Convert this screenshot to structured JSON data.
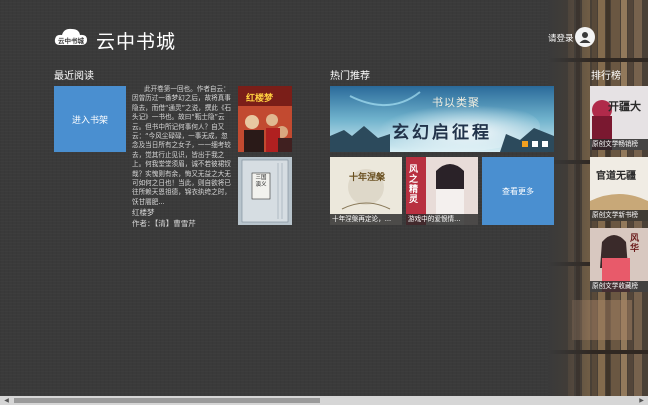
{
  "header": {
    "logo_text": "云中书城",
    "title": "云中书城",
    "login_label": "请登录"
  },
  "recent": {
    "heading": "最近阅读",
    "enter_shelf_label": "进入书架",
    "summary": "此开卷第一回也。作者自云：因曾历过一番梦幻之后，故将真事隐去，而借“通灵”之说，撰此《石头记》一书也。故曰“甄士隐”云云。但书中所记何事何人？自又云：“今风尘碌碌，一事无成，忽念及当日所有之女子，一一细考较去，觉其行止见识，皆出于我之上。何我堂堂须眉，诚不若彼裙钗哉？实愧则有余，悔又无益之大无可如何之日也！当此，则自欲将已往所赖天恩祖德，锦衣纨绔之时，饫甘餍肥...",
    "book_title": "红楼梦",
    "book_author": "作者：【清】曹雪芹",
    "cover_top_text": "红楼梦",
    "cover_bottom_text": "三国演义"
  },
  "hot": {
    "heading": "热门推荐",
    "banner_line1": "书以类聚",
    "banner_line2": "玄幻启征程",
    "tiles": [
      {
        "caption": "十年涅槃再定论，...",
        "cover_text": "十年涅槃"
      },
      {
        "caption": "游戏中的爱恨情...",
        "cover_text": "风之精灵"
      }
    ],
    "more_label": "查看更多"
  },
  "ranking": {
    "heading": "排行榜",
    "items": [
      {
        "caption": "原创文学畅销榜",
        "cover_text": "开疆大"
      },
      {
        "caption": "原创文学新书榜",
        "cover_text": "官道无疆"
      },
      {
        "caption": "原创文学收藏榜",
        "cover_text": "风华"
      }
    ]
  },
  "colors": {
    "tile_blue": "#4a8fd0",
    "carousel_active": "#f2a020"
  }
}
